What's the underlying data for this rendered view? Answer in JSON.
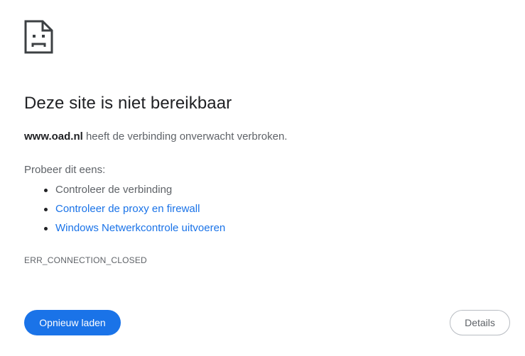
{
  "icon": "sad-page-icon",
  "title": "Deze site is niet bereikbaar",
  "summary": {
    "host": "www.oad.nl",
    "message": " heeft de verbinding onverwacht verbroken."
  },
  "suggestions": {
    "label": "Probeer dit eens:",
    "items": [
      {
        "text": "Controleer de verbinding",
        "link": false
      },
      {
        "text": "Controleer de proxy en firewall",
        "link": true
      },
      {
        "text": "Windows Netwerkcontrole uitvoeren",
        "link": true
      }
    ]
  },
  "error_code": "ERR_CONNECTION_CLOSED",
  "buttons": {
    "reload_label": "Opnieuw laden",
    "details_label": "Details"
  },
  "colors": {
    "accent": "#1a73e8",
    "text_primary": "#202124",
    "text_secondary": "#5f6368"
  }
}
